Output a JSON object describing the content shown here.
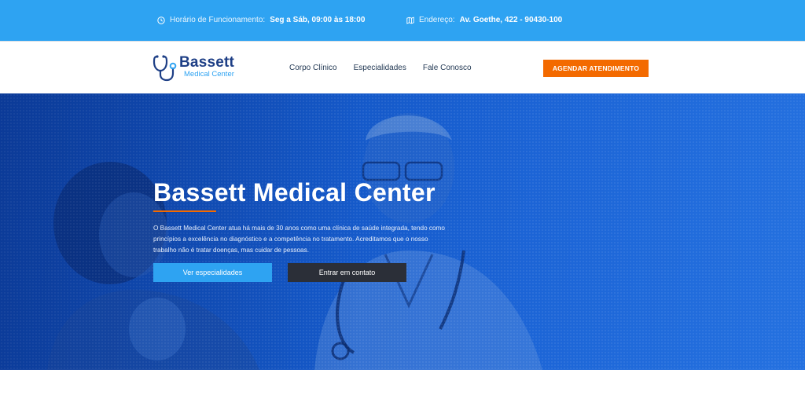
{
  "topbar": {
    "hours_label": "Horário de Funcionamento:",
    "hours_value": "Seg a Sáb, 09:00 às 18:00",
    "address_label": "Endereço:",
    "address_value": "Av. Goethe, 422 - 90430-100"
  },
  "header": {
    "logo_name": "Bassett",
    "logo_sub": "Medical Center",
    "nav": [
      "Corpo Clínico",
      "Especialidades",
      "Fale Conosco"
    ],
    "cta_label": "AGENDAR ATENDIMENTO"
  },
  "hero": {
    "title": "Bassett Medical Center",
    "description": "O Bassett Medical Center atua há mais de 30 anos como uma clínica de saúde integrada, tendo como princípios a excelência no diagnóstico e a competência no tratamento. Acreditamos que o nosso trabalho não é tratar doenças, mas cuidar de pessoas.",
    "btn_primary": "Ver especialidades",
    "btn_secondary": "Entrar em contato"
  },
  "colors": {
    "topbar": "#2ea3f2",
    "brand_dark": "#1e3f86",
    "cta": "#f36a00",
    "hero": "#1458c8",
    "btn_dark": "#2b2f38"
  },
  "icons": [
    "clock-icon",
    "map-icon",
    "stethoscope-logo-icon"
  ]
}
